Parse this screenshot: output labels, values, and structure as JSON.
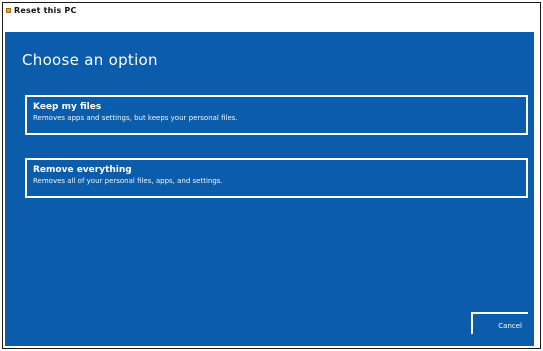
{
  "window": {
    "title": "Reset this PC"
  },
  "main": {
    "heading": "Choose an option",
    "options": [
      {
        "title": "Keep my files",
        "description": "Removes apps and settings, but keeps your personal files."
      },
      {
        "title": "Remove everything",
        "description": "Removes all of your personal files, apps, and settings."
      }
    ],
    "cancel_label": "Cancel"
  },
  "colors": {
    "background": "#0b5cab",
    "text": "#ffffff"
  }
}
